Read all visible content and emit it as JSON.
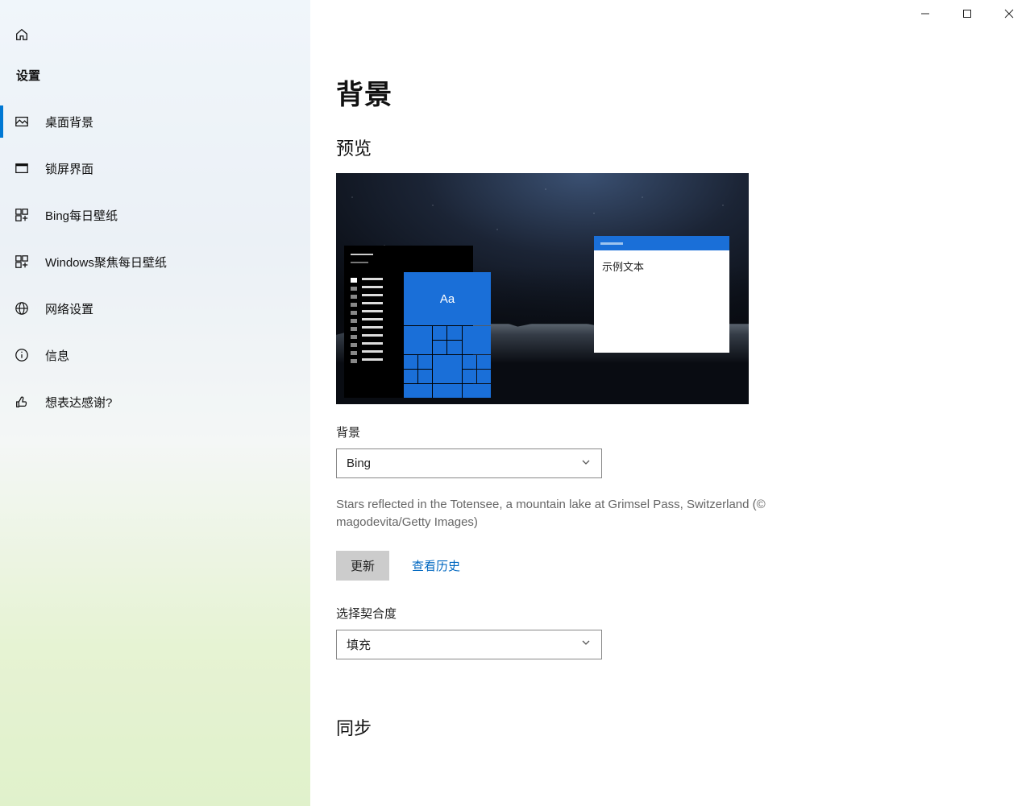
{
  "titlebar": {
    "minimize": "minimize",
    "maximize": "maximize",
    "close": "close"
  },
  "sidebar": {
    "settings_label": "设置",
    "items": [
      {
        "label": "桌面背景",
        "icon": "image-icon",
        "active": true
      },
      {
        "label": "锁屏界面",
        "icon": "lock-screen-icon"
      },
      {
        "label": "Bing每日壁纸",
        "icon": "grid-icon"
      },
      {
        "label": "Windows聚焦每日壁纸",
        "icon": "grid-icon"
      },
      {
        "label": "网络设置",
        "icon": "globe-icon"
      },
      {
        "label": "信息",
        "icon": "info-icon"
      },
      {
        "label": "想表达感谢?",
        "icon": "thumbs-up-icon"
      }
    ]
  },
  "main": {
    "title": "背景",
    "preview_label": "预览",
    "preview_sample_text": "示例文本",
    "preview_aa": "Aa",
    "background_label": "背景",
    "background_select_value": "Bing",
    "description": "Stars reflected in the Totensee, a mountain lake at Grimsel Pass, Switzerland (© magodevita/Getty Images)",
    "update_button": "更新",
    "history_link": "查看历史",
    "fit_label": "选择契合度",
    "fit_select_value": "填充",
    "sync_heading": "同步"
  }
}
